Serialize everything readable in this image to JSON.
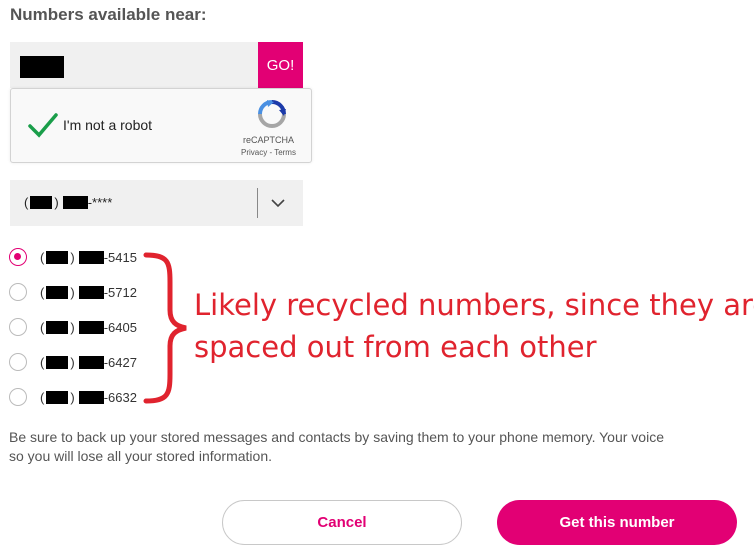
{
  "header": {
    "title": "Numbers available near:"
  },
  "search": {
    "go_label": "GO!"
  },
  "captcha": {
    "label": "I'm not a robot",
    "brand": "reCAPTCHA",
    "links": "Privacy - Terms"
  },
  "area_select": {
    "suffix": "-****"
  },
  "numbers": [
    {
      "suffix": "-5415",
      "selected": true
    },
    {
      "suffix": "-5712",
      "selected": false
    },
    {
      "suffix": "-6405",
      "selected": false
    },
    {
      "suffix": "-6427",
      "selected": false
    },
    {
      "suffix": "-6632",
      "selected": false
    }
  ],
  "annotation": {
    "line1": "Likely recycled numbers, since they are",
    "line2": "spaced out from each other",
    "color": "#e0232e"
  },
  "disclaimer": {
    "line1": "Be sure to back up your stored messages and contacts by saving them to your phone memory. Your voice",
    "line2": "so you will lose all your stored information."
  },
  "actions": {
    "cancel_label": "Cancel",
    "confirm_label": "Get this number"
  },
  "colors": {
    "brand": "#e20074"
  }
}
